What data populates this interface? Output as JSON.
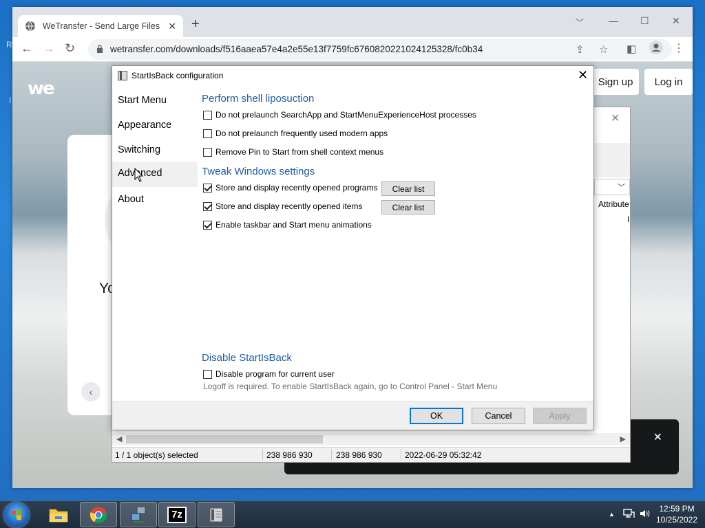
{
  "desktop": {
    "letter_top": "R",
    "letter_mid": "I"
  },
  "browser": {
    "tab_title": "WeTransfer - Send Large Files &",
    "url": "wetransfer.com/downloads/f516aaea57e4a2e55e13f7759fc6760820221024125328/fc0b34",
    "page": {
      "logo": "we",
      "signup": "Sign up",
      "login": "Log in",
      "card_text": "Yo"
    }
  },
  "zip_window": {
    "column_header": "Attribute",
    "status": {
      "selected": "1 / 1 object(s) selected",
      "size": "238 986 930",
      "packed": "238 986 930",
      "modified": "2022-06-29 05:32:42"
    }
  },
  "dialog": {
    "title": "StartIsBack configuration",
    "nav": [
      "Start Menu",
      "Appearance",
      "Switching",
      "Advanced",
      "About"
    ],
    "selected_nav": "Advanced",
    "sections": {
      "shell": {
        "heading": "Perform shell liposuction",
        "options": [
          {
            "label": "Do not prelaunch SearchApp and StartMenuExperienceHost processes",
            "checked": false
          },
          {
            "label": "Do not prelaunch frequently used modern apps",
            "checked": false
          },
          {
            "label": "Remove Pin to Start from shell context menus",
            "checked": false
          }
        ]
      },
      "tweak": {
        "heading": "Tweak Windows settings",
        "options": [
          {
            "label": "Store and display recently opened programs",
            "checked": true
          },
          {
            "label": "Store and display recently opened items",
            "checked": true
          },
          {
            "label": "Enable taskbar and Start menu animations",
            "checked": true
          }
        ],
        "clear_list_label": "Clear list"
      },
      "disable": {
        "heading": "Disable StartIsBack",
        "option": {
          "label": "Disable program for current user",
          "checked": false
        },
        "note": "Logoff is required. To enable StartIsBack again, go to Control Panel - Start Menu"
      }
    },
    "buttons": {
      "ok": "OK",
      "cancel": "Cancel",
      "apply": "Apply"
    }
  },
  "taskbar": {
    "time": "12:59 PM",
    "date": "10/25/2022",
    "app_7z": "7z"
  }
}
